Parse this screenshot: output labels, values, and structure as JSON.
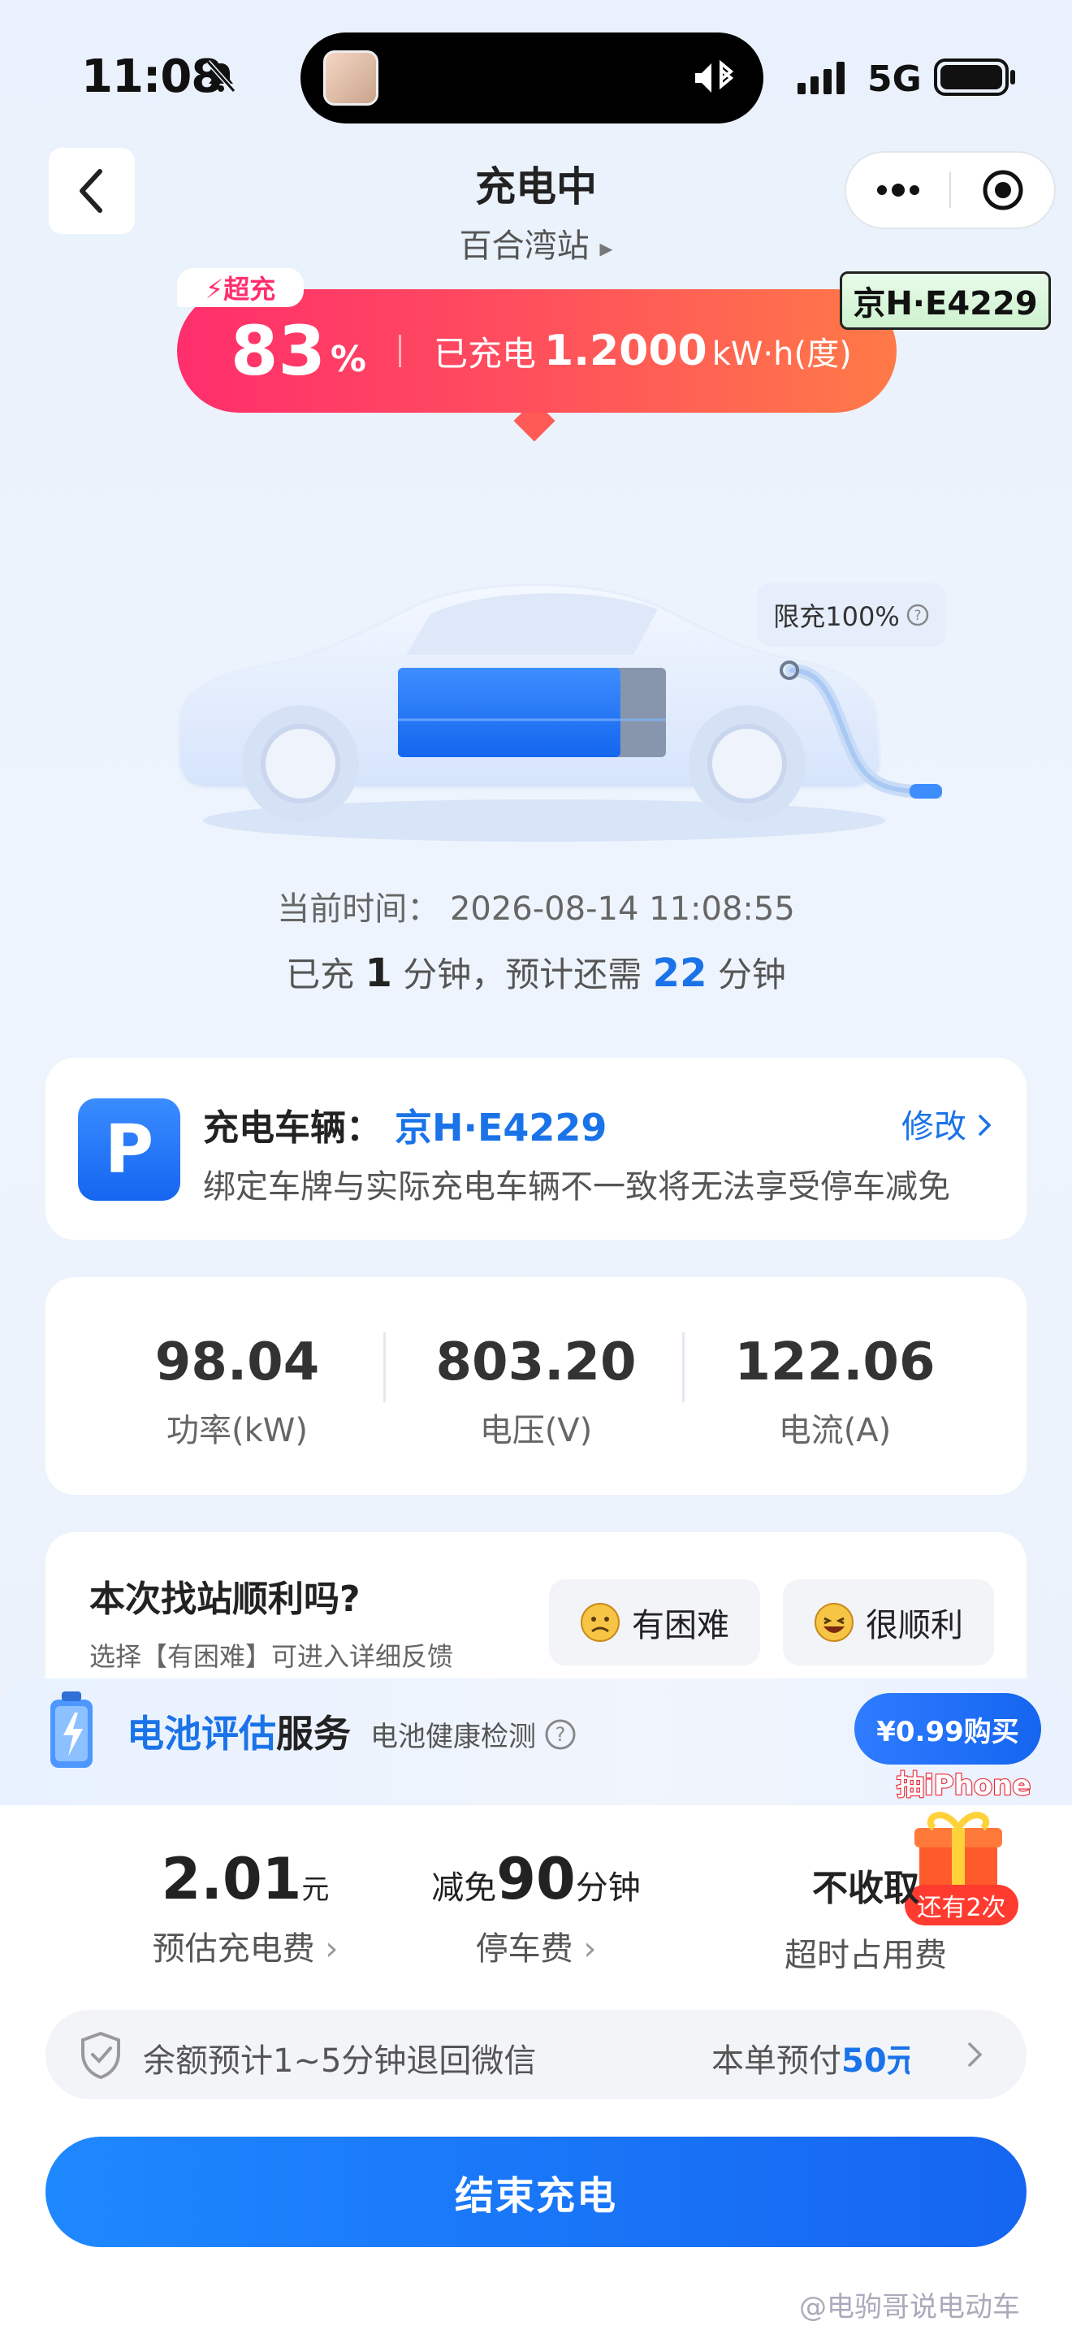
{
  "status_bar": {
    "time": "11:08",
    "network": "5G"
  },
  "nav": {
    "title": "充电中",
    "station": "百合湾站",
    "station_chevron": "▸"
  },
  "banner": {
    "super_tag": "⚡超充",
    "percent": "83",
    "percent_unit": "%",
    "charged_label": "已充电",
    "charged_value": "1.2000",
    "charged_unit": "kW·h(度)",
    "plate": "京H·E4229"
  },
  "car": {
    "limit_label": "限充100%",
    "battery_level": 0.83
  },
  "progress": {
    "now_label": "当前时间：",
    "now_value": "2026-08-14 11:08:55",
    "charged_prefix": "已充",
    "charged_minutes": "1",
    "mid_text": "分钟，预计还需",
    "remaining_minutes": "22",
    "suffix": "分钟"
  },
  "vehicle": {
    "icon_letter": "P",
    "label": "充电车辆：",
    "plate": "京H·E4229",
    "edit": "修改",
    "warning": "绑定车牌与实际充电车辆不一致将无法享受停车减免"
  },
  "stats": [
    {
      "value": "98.04",
      "label": "功率(kW)"
    },
    {
      "value": "803.20",
      "label": "电压(V)"
    },
    {
      "value": "122.06",
      "label": "电流(A)"
    }
  ],
  "feedback": {
    "title": "本次找站顺利吗?",
    "subtitle": "选择【有困难】可进入详细反馈",
    "hard": "有困难",
    "smooth": "很顺利"
  },
  "battery_service": {
    "title_a": "电池评估",
    "title_b": "服务",
    "subtitle": "电池健康检测",
    "buy": "¥0.99购买",
    "promo": "抽iPhone",
    "remaining": "还有2次"
  },
  "fees": {
    "charge_value": "2.01",
    "charge_unit": "元",
    "charge_label": "预估充电费",
    "parking_prefix": "减免",
    "parking_value": "90",
    "parking_unit": "分钟",
    "parking_label": "停车费",
    "overtime_value": "不收取",
    "overtime_label": "超时占用费"
  },
  "refund": {
    "text": "余额预计1~5分钟退回微信",
    "prepay_label": "本单预付",
    "prepay_amount": "50元"
  },
  "end_button": "结束充电",
  "watermark": "@电驹哥说电动车",
  "colors": {
    "accent": "#1a73e8",
    "banner_start": "#ff2e6c",
    "banner_end": "#ff7a47"
  }
}
